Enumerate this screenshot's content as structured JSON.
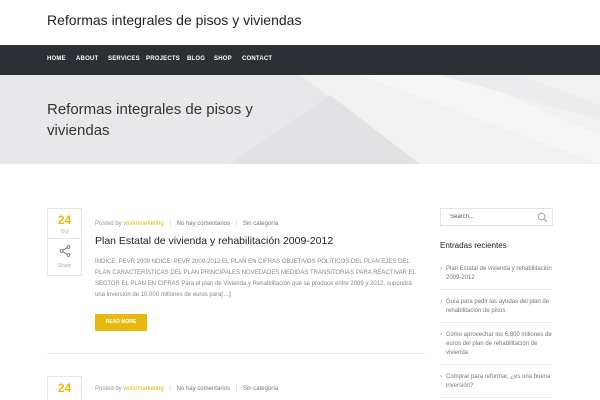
{
  "site": {
    "title": "Reformas integrales de pisos y viviendas"
  },
  "nav": {
    "items": [
      "HOME",
      "ABOUT",
      "SERVICES",
      "PROJECTS",
      "BLOG",
      "SHOP",
      "CONTACT"
    ]
  },
  "hero": {
    "title": "Reformas integrales de pisos y viviendas"
  },
  "posts": [
    {
      "day": "24",
      "month": "Oct",
      "share_label": "Share",
      "meta": {
        "posted_by_label": "Posted by",
        "author": "workimarketing",
        "comments": "No hay comentarios",
        "category": "Sin categoría"
      },
      "title": "Plan Estatal de vivienda y rehabilitación 2009-2012",
      "excerpt": "ÍNDICE: PEVR 2009 NDICE: PEVR 2009-2012 EL PLAN EN CIFRAS OBJETIVOS POLÍTICOS DEL PLAN EJES DEL PLAN CARACTERÍSTICAS DEL PLAN PRINCIPALES NOVEDADES MEDIDAS TRANSITORIAS PARA REACTIVAR EL SECTOR EL PLAN EN CIFRAS Para el plan de Vivienda y Rehabilitación que se produce entre 2009 y 2012, supondrá una inversión de 10.000 millones de euros para[…]",
      "read_more": "READ MORE"
    },
    {
      "day": "24",
      "meta": {
        "posted_by_label": "Posted by",
        "author": "workimarketing",
        "comments": "No hay comentarios",
        "category": "Sin categoría"
      }
    }
  ],
  "sidebar": {
    "search": {
      "placeholder": "Search..."
    },
    "recent_title": "Entradas recientes",
    "recent_items": [
      "Plan Estatal de vivienda y rehabilitación 2009-2012",
      "Guía para pedir las ayudas del plan de rehabilitación de pisos",
      "Cómo aprovechar los 6.800 millones de euros del plan de rehabilitación de vivienda",
      "Comprar para reformar, ¿es una buena inversión?"
    ]
  },
  "colors": {
    "accent": "#e8b80c",
    "nav_bg": "#2c2f33",
    "hero_bg": "#e8e8ea"
  },
  "icons": {
    "share": "share-icon",
    "search": "search-icon"
  }
}
